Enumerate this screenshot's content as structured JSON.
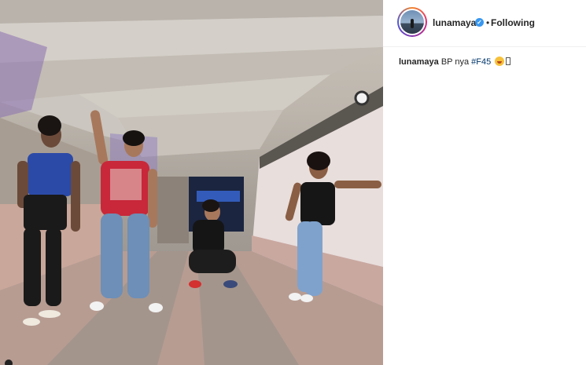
{
  "post": {
    "author": {
      "username": "lunamaya",
      "verified_icon": "verified-badge-icon",
      "separator": "•",
      "follow_status": "Following"
    },
    "caption": {
      "username": "lunamaya",
      "text": "BP nya",
      "hashtag": "#F45",
      "emoji_icon": "tongue-out-face-icon"
    },
    "photo": {
      "content_icon": "group-photo-underpass"
    },
    "colors": {
      "verified": "#3897f0",
      "hashtag": "#003569",
      "text": "#262626"
    }
  }
}
